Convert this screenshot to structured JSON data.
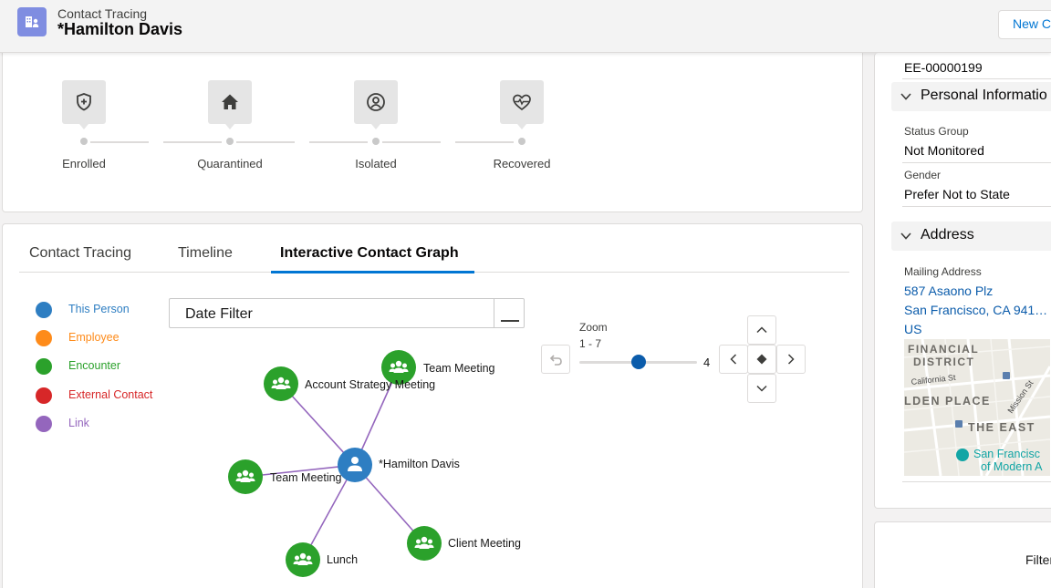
{
  "header": {
    "object_type": "Contact Tracing",
    "record_name": "*Hamilton Davis",
    "new_button": "New Co"
  },
  "path": {
    "steps": [
      {
        "label": "Enrolled",
        "icon": "shield-plus-icon"
      },
      {
        "label": "Quarantined",
        "icon": "home-icon"
      },
      {
        "label": "Isolated",
        "icon": "person-circle-icon"
      },
      {
        "label": "Recovered",
        "icon": "heart-pulse-icon"
      }
    ]
  },
  "tabs": {
    "items": [
      "Contact Tracing",
      "Timeline",
      "Interactive Contact Graph"
    ],
    "active": "Interactive Contact Graph"
  },
  "legend": {
    "items": [
      {
        "label": "This Person",
        "color": "#2e7ec2"
      },
      {
        "label": "Employee",
        "color": "#fe8b1a"
      },
      {
        "label": "Encounter",
        "color": "#2ba12b"
      },
      {
        "label": "External Contact",
        "color": "#d72728"
      },
      {
        "label": "Link",
        "color": "#9466bd"
      }
    ]
  },
  "date_filter": {
    "label": "Date Filter"
  },
  "zoom": {
    "label": "Zoom",
    "range": "1 - 7",
    "value": "4",
    "min": 1,
    "max": 7,
    "current": 4
  },
  "graph": {
    "center": {
      "label": "*Hamilton Davis",
      "color": "#2e7ec2"
    },
    "nodes": [
      {
        "label": "Team Meeting",
        "color": "#2ba12b"
      },
      {
        "label": "Account Strategy Meeting",
        "color": "#2ba12b"
      },
      {
        "label": "Team Meeting",
        "color": "#2ba12b"
      },
      {
        "label": "Client Meeting",
        "color": "#2ba12b"
      },
      {
        "label": "Lunch",
        "color": "#2ba12b"
      }
    ],
    "link_color": "#9466bd"
  },
  "sidebar": {
    "employee_id": "EE-00000199",
    "personal_section": "Personal Informatio",
    "status_group_label": "Status Group",
    "status_group_value": "Not Monitored",
    "gender_label": "Gender",
    "gender_value": "Prefer Not to State",
    "address_section": "Address",
    "mailing_label": "Mailing Address",
    "street": "587 Asaono Plz",
    "city": "San Francisco, CA 941…",
    "country": "US",
    "map": {
      "district1": "FINANCIAL",
      "district2": "DISTRICT",
      "street1": "California St",
      "place": "LDEN PLACE",
      "street2": "Mission St",
      "the_east": "THE EAST",
      "museum1": "San Francisc",
      "museum2": "of Modern A"
    }
  },
  "sidebar2": {
    "label": "Filter"
  }
}
